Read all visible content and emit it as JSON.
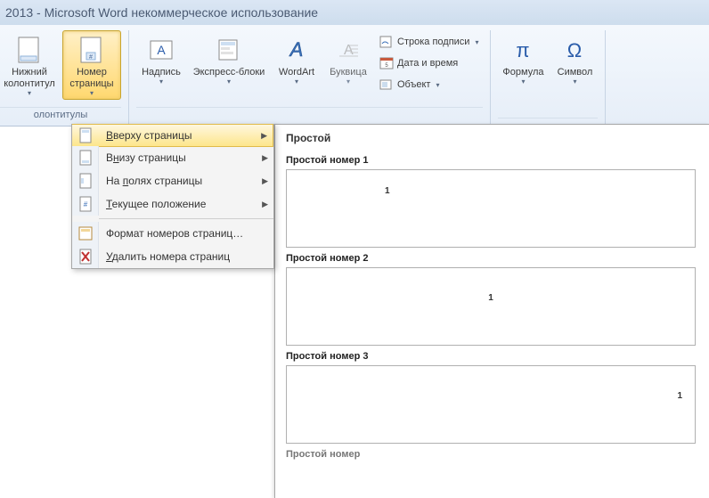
{
  "titlebar": "2013  -  Microsoft Word некоммерческое использование",
  "ribbon": {
    "footer_btn": "Нижний\nколонтитул",
    "page_number_btn": "Номер\nстраницы",
    "textbox_btn": "Надпись",
    "quickparts_btn": "Экспресс-блоки",
    "wordart_btn": "WordArt",
    "dropcap_btn": "Буквица",
    "signature_line": "Строка подписи",
    "date_time": "Дата и время",
    "object": "Объект",
    "equation_btn": "Формула",
    "symbol_btn": "Символ",
    "group_headerfooter": "олонтитулы",
    "group_symbols": ""
  },
  "menu": {
    "top_of_page": "Вверху страницы",
    "bottom_of_page": "Внизу страницы",
    "page_margins": "На полях страницы",
    "current_position": "Текущее положение",
    "format_numbers": "Формат номеров страниц…",
    "remove_numbers": "Удалить номера страниц",
    "underline_top": "В",
    "underline_bottom_rest": "низу страницы",
    "underline_margins_pref": "На ",
    "underline_margins_u": "п",
    "underline_margins_rest": "олях страницы",
    "underline_current_u": "Т",
    "underline_current_rest": "екущее положение",
    "underline_remove_u": "У",
    "underline_remove_rest": "далить номера страниц"
  },
  "gallery": {
    "header": "Простой",
    "item1": "Простой номер 1",
    "item2": "Простой номер 2",
    "item3": "Простой номер 3",
    "item4": "Простой номер",
    "sample_number": "1"
  }
}
